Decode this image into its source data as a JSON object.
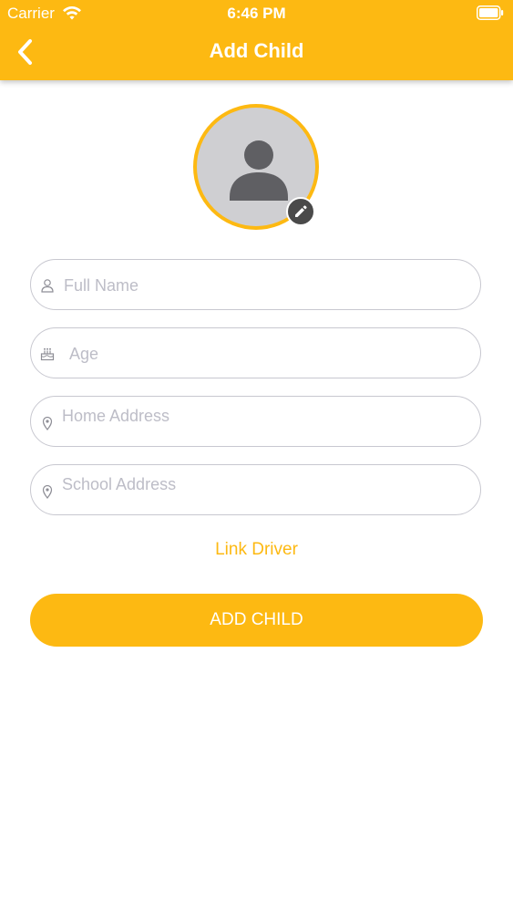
{
  "status_bar": {
    "carrier": "Carrier",
    "time": "6:46 PM"
  },
  "nav": {
    "title": "Add Child",
    "back_icon": "chevron-left-icon"
  },
  "avatar": {
    "icon": "user-silhouette-icon",
    "edit_icon": "pencil-icon"
  },
  "form": {
    "full_name": {
      "placeholder": "Full Name",
      "icon": "user-icon"
    },
    "age": {
      "placeholder": "Age",
      "icon": "birthday-cake-icon"
    },
    "home_address": {
      "placeholder": "Home Address",
      "icon": "location-pin-icon"
    },
    "school_address": {
      "placeholder": "School Address",
      "icon": "location-pin-icon"
    }
  },
  "link_driver": "Link Driver",
  "submit_label": "ADD CHILD",
  "colors": {
    "accent": "#FDB912",
    "field_border": "#C8C8D0",
    "placeholder": "#BDBDC7",
    "avatar_bg": "#CFCFD2"
  }
}
